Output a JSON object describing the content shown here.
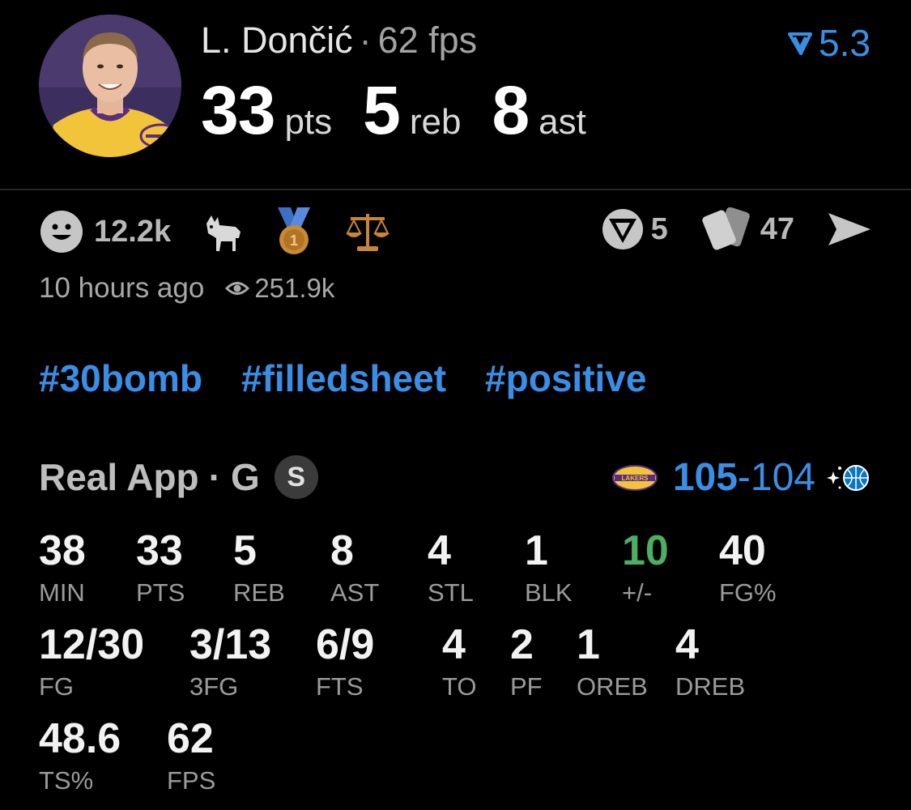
{
  "header": {
    "player_name": "L. Dončić",
    "separator": "·",
    "fps_text": "62 fps",
    "rating_value": "5.3",
    "big_stats": [
      {
        "value": "33",
        "unit": "pts"
      },
      {
        "value": "5",
        "unit": "reb"
      },
      {
        "value": "8",
        "unit": "ast"
      }
    ]
  },
  "reactions": {
    "smile_count": "12.2k",
    "icons": [
      "smile-icon",
      "goat-icon",
      "medal-icon",
      "scales-icon"
    ],
    "predictions_count": "5",
    "cards_count": "47"
  },
  "meta": {
    "time_ago": "10 hours ago",
    "views": "251.9k"
  },
  "tags": [
    "#30bomb",
    "#filledsheet",
    "#positive"
  ],
  "game": {
    "source": "Real App",
    "separator": "·",
    "position": "G",
    "badge": "S",
    "score_home": "105",
    "score_dash": "-",
    "score_away": "104"
  },
  "stats": [
    {
      "value": "38",
      "label": "MIN"
    },
    {
      "value": "33",
      "label": "PTS"
    },
    {
      "value": "5",
      "label": "REB"
    },
    {
      "value": "8",
      "label": "AST"
    },
    {
      "value": "4",
      "label": "STL"
    },
    {
      "value": "1",
      "label": "BLK"
    },
    {
      "value": "10",
      "label": "+/-"
    },
    {
      "value": "40",
      "label": "FG%"
    },
    {
      "value": "12/30",
      "label": "FG"
    },
    {
      "value": "3/13",
      "label": "3FG"
    },
    {
      "value": "6/9",
      "label": "FTS"
    },
    {
      "value": "4",
      "label": "TO"
    },
    {
      "value": "2",
      "label": "PF"
    },
    {
      "value": "1",
      "label": "OREB"
    },
    {
      "value": "4",
      "label": "DREB"
    },
    {
      "value": "48.6",
      "label": "TS%"
    },
    {
      "value": "62",
      "label": "FPS"
    }
  ],
  "colors": {
    "accent_blue": "#3a8ee6",
    "positive_green": "#4caf64",
    "background": "#000000"
  }
}
